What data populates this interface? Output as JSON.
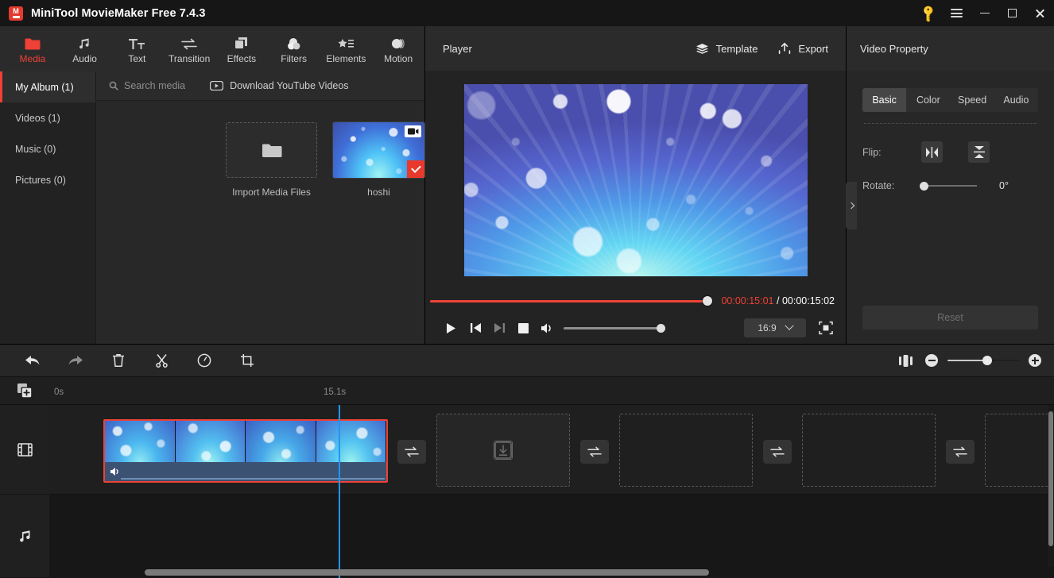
{
  "titlebar": {
    "app_title": "MiniTool MovieMaker Free 7.4.3",
    "logo_letter": "M",
    "buttons": {
      "key": "key-icon",
      "menu": "hamburger-menu-icon",
      "minimize": "minimize-icon",
      "maximize": "maximize-icon",
      "close": "close-icon"
    }
  },
  "ribbon": {
    "items": [
      {
        "label": "Media",
        "icon": "folder-icon",
        "active": true
      },
      {
        "label": "Audio",
        "icon": "music-note-icon",
        "active": false
      },
      {
        "label": "Text",
        "icon": "text-icon",
        "active": false
      },
      {
        "label": "Transition",
        "icon": "transition-icon",
        "active": false
      },
      {
        "label": "Effects",
        "icon": "effects-icon",
        "active": false
      },
      {
        "label": "Filters",
        "icon": "filters-icon",
        "active": false
      },
      {
        "label": "Elements",
        "icon": "elements-icon",
        "active": false
      },
      {
        "label": "Motion",
        "icon": "motion-icon",
        "active": false
      }
    ]
  },
  "media": {
    "albums": [
      {
        "label": "My Album (1)",
        "selected": true
      },
      {
        "label": "Videos (1)",
        "selected": false
      },
      {
        "label": "Music (0)",
        "selected": false
      },
      {
        "label": "Pictures (0)",
        "selected": false
      }
    ],
    "search_placeholder": "Search media",
    "youtube_label": "Download YouTube Videos",
    "import_label": "Import Media Files",
    "items": [
      {
        "name": "hoshi",
        "type": "video",
        "selected": true
      }
    ]
  },
  "player": {
    "title": "Player",
    "template_label": "Template",
    "export_label": "Export",
    "current_time": "00:00:15:01",
    "time_separator": "/",
    "total_time": "00:00:15:02",
    "progress_percent": 99,
    "volume_percent": 100,
    "aspect_ratio": "16:9",
    "controls": {
      "play": "play-icon",
      "prev_frame": "previous-frame-icon",
      "next_frame": "next-frame-icon",
      "stop": "stop-icon",
      "volume": "volume-icon",
      "fullscreen": "fullscreen-icon"
    }
  },
  "property": {
    "title": "Video Property",
    "tabs": [
      {
        "label": "Basic",
        "selected": true
      },
      {
        "label": "Color",
        "selected": false
      },
      {
        "label": "Speed",
        "selected": false
      },
      {
        "label": "Audio",
        "selected": false
      }
    ],
    "flip_label": "Flip:",
    "flip_horizontal": "flip-horizontal-icon",
    "flip_vertical": "flip-vertical-icon",
    "rotate_label": "Rotate:",
    "rotate_value": "0°",
    "rotate_percent": 0,
    "reset_label": "Reset"
  },
  "timeline": {
    "toolbar": [
      {
        "name": "undo",
        "icon": "undo-icon"
      },
      {
        "name": "redo",
        "icon": "redo-icon"
      },
      {
        "name": "delete",
        "icon": "trash-icon"
      },
      {
        "name": "split",
        "icon": "scissors-icon"
      },
      {
        "name": "speed",
        "icon": "speed-icon"
      },
      {
        "name": "crop",
        "icon": "crop-icon"
      }
    ],
    "split_view_icon": "split-view-icon",
    "zoom_out_icon": "zoom-out-icon",
    "zoom_in_icon": "zoom-in-icon",
    "zoom_percent": 55,
    "ruler": {
      "start_label": "0s",
      "playhead_label": "15.1s"
    },
    "tracks": [
      {
        "name": "add-track",
        "icon": "add-media-icon"
      },
      {
        "name": "video-track",
        "icon": "film-icon"
      },
      {
        "name": "audio-track",
        "icon": "music-note-icon"
      }
    ],
    "clip": {
      "name": "hoshi",
      "selected": true,
      "muted": false
    },
    "transition_icon": "transition-icon",
    "placeholder_download_icon": "download-icon"
  },
  "colors": {
    "accent_red": "#ef4136",
    "playhead_blue": "#2196f3",
    "panel_bg": "#232323",
    "titlebar_bg": "#161616"
  }
}
